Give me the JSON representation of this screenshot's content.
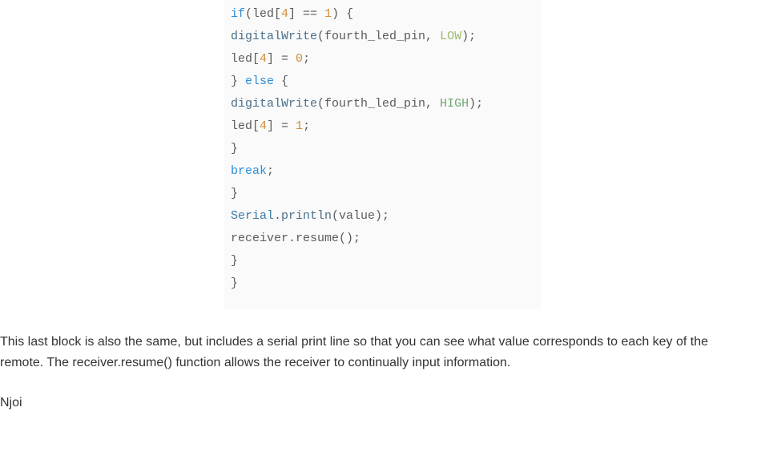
{
  "code": {
    "l1": {
      "a": "if",
      "b": "(led[",
      "c": "4",
      "d": "] == ",
      "e": "1",
      "f": ") {"
    },
    "l2": {
      "a": "digitalWrite",
      "b": "(fourth_led_pin, ",
      "c": "LOW",
      "d": ");"
    },
    "l3": {
      "a": "led[",
      "b": "4",
      "c": "] = ",
      "d": "0",
      "e": ";"
    },
    "l4": {
      "a": "} ",
      "b": "else",
      "c": " {"
    },
    "l5": {
      "a": "digitalWrite",
      "b": "(fourth_led_pin, ",
      "c": "HIGH",
      "d": ");"
    },
    "l6": {
      "a": "led[",
      "b": "4",
      "c": "] = ",
      "d": "1",
      "e": ";"
    },
    "l7": "}",
    "l8": {
      "a": "break",
      "b": ";"
    },
    "l9": "}",
    "l10": {
      "a": "Serial",
      "b": ".",
      "c": "println",
      "d": "(value);"
    },
    "l11": "receiver.resume();",
    "l12": "}",
    "l13": "}"
  },
  "paragraph": "This last block is also the same, but includes a serial print line so that you can see what value corresponds to each key of the remote. The receiver.resume() function allows the receiver to continually input information.",
  "signoff": "Njoi"
}
